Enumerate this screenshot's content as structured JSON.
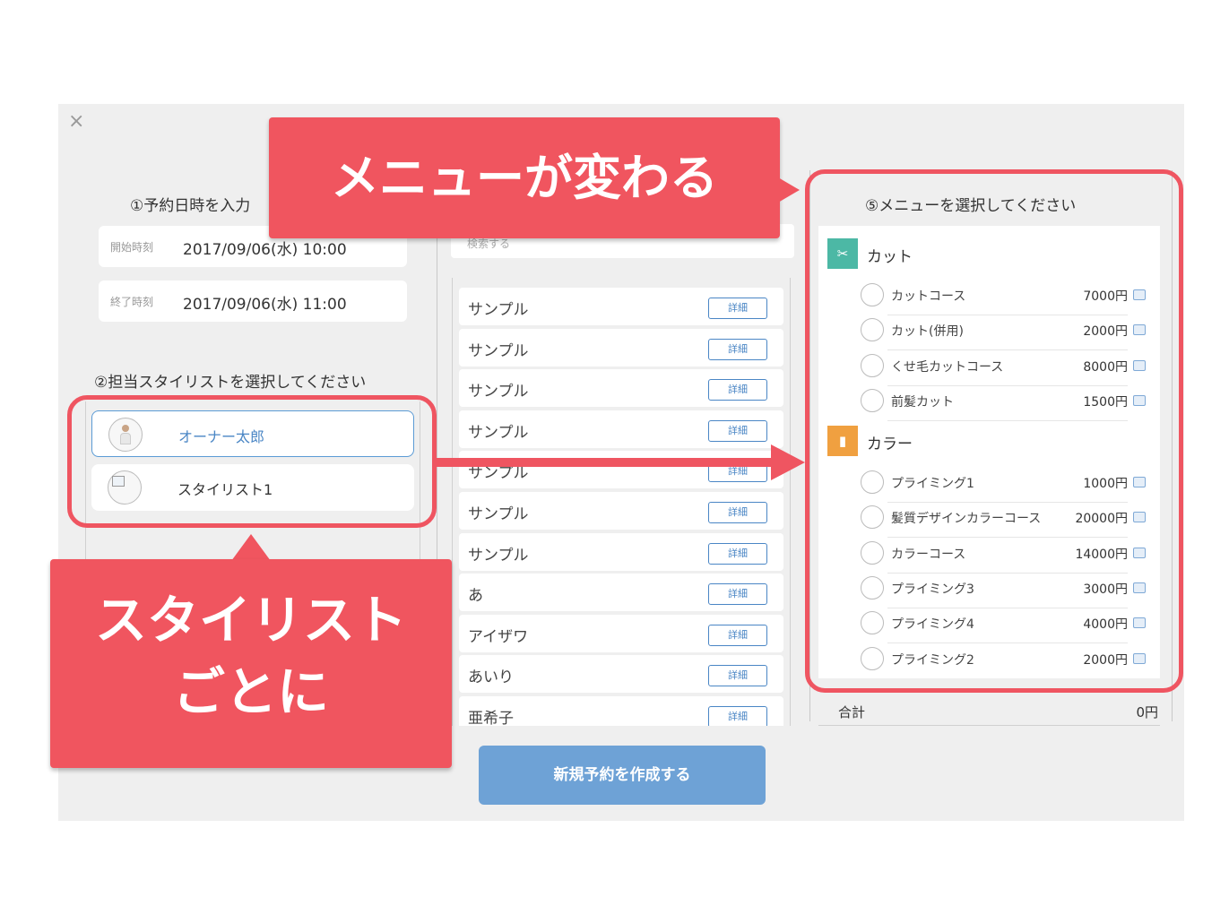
{
  "close_label": "×",
  "step1": {
    "title": "①予約日時を入力",
    "start_label": "開始時刻",
    "start_value": "2017/09/06(水) 10:00",
    "end_label": "終了時刻",
    "end_value": "2017/09/06(水) 11:00"
  },
  "step2": {
    "title": "②担当スタイリストを選択してください",
    "stylists": [
      {
        "name": "オーナー太郎",
        "selected": true
      },
      {
        "name": "スタイリスト1",
        "selected": false
      }
    ]
  },
  "middle": {
    "search_placeholder": "検索する",
    "detail_label": "詳細",
    "items": [
      "サンプル",
      "サンプル",
      "サンプル",
      "サンプル",
      "サンプル",
      "サンプル",
      "サンプル",
      "あ",
      "アイザワ",
      "あいり",
      "亜希子"
    ]
  },
  "step5": {
    "title": "⑤メニューを選択してください",
    "categories": [
      {
        "name": "カット",
        "icon": "scissors-icon",
        "color": "#4cb8a5",
        "options": [
          {
            "name": "カットコース",
            "price": "7000円"
          },
          {
            "name": "カット(併用)",
            "price": "2000円"
          },
          {
            "name": "くせ毛カットコース",
            "price": "8000円"
          },
          {
            "name": "前髪カット",
            "price": "1500円"
          }
        ]
      },
      {
        "name": "カラー",
        "icon": "bottle-icon",
        "color": "#f0a040",
        "options": [
          {
            "name": "プライミング1",
            "price": "1000円"
          },
          {
            "name": "髪質デザインカラーコース",
            "price": "20000円"
          },
          {
            "name": "カラーコース",
            "price": "14000円"
          },
          {
            "name": "プライミング3",
            "price": "3000円"
          },
          {
            "name": "プライミング4",
            "price": "4000円"
          },
          {
            "name": "プライミング2",
            "price": "2000円"
          }
        ]
      }
    ],
    "total_label": "合計",
    "total_value": "0円"
  },
  "create_button": "新規予約を作成する",
  "annotations": {
    "menu_changes": "メニューが変わる",
    "per_stylist_line1": "スタイリスト",
    "per_stylist_line2": "ごとに",
    "accent_color": "#f0555f"
  }
}
